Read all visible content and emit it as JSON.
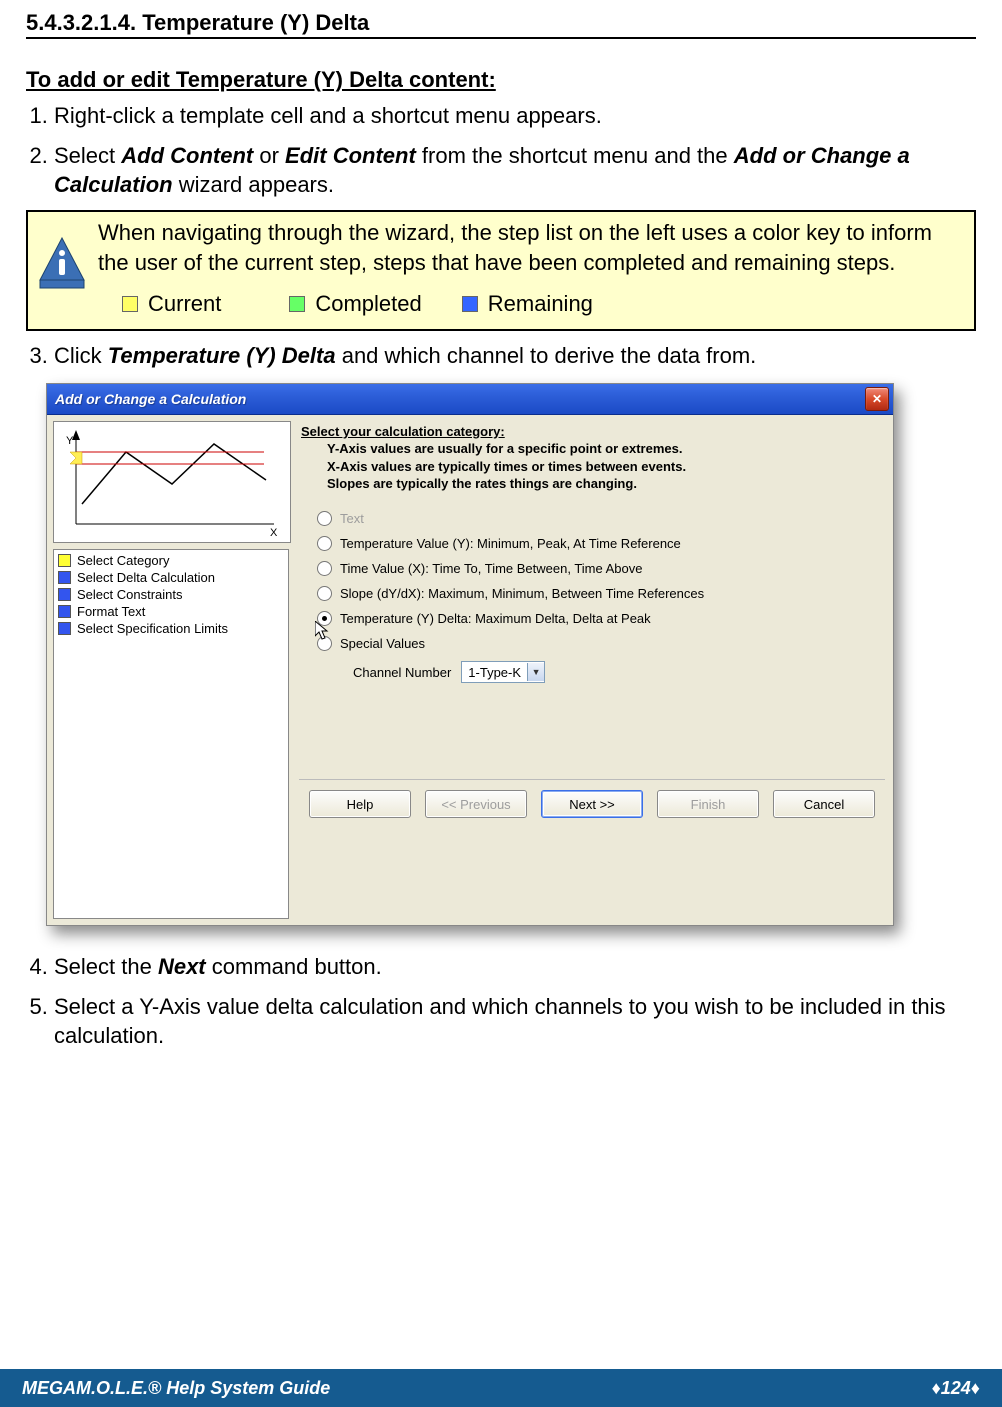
{
  "section": {
    "number": "5.4.3.2.1.4.",
    "title": "Temperature (Y) Delta"
  },
  "intro": {
    "heading": "To add or edit Temperature (Y) Delta content:"
  },
  "steps": {
    "s1": "Right-click a template cell and a shortcut menu appears.",
    "s2_a": "Select ",
    "s2_add": "Add Content",
    "s2_or": " or ",
    "s2_edit": "Edit Content",
    "s2_b": " from the shortcut menu and the ",
    "s2_wiz": "Add or Change a Calculation",
    "s2_c": " wizard appears.",
    "s3_a": "Click ",
    "s3_b": "Temperature (Y) Delta",
    "s3_c": " and which channel to derive the data from.",
    "s4_a": "Select the ",
    "s4_b": "Next",
    "s4_c": " command button.",
    "s5": "Select a Y-Axis value delta calculation and which channels to you wish to be included in this calculation."
  },
  "info": {
    "text": "When navigating through the wizard, the step list on the left uses a color key to inform the user of the current step, steps that have been completed and remaining steps.",
    "legend": {
      "current": "Current",
      "completed": "Completed",
      "remaining": "Remaining"
    }
  },
  "dialog": {
    "title": "Add or Change a Calculation",
    "steps": [
      {
        "color": "y",
        "label": "Select Category"
      },
      {
        "color": "b",
        "label": "Select Delta Calculation"
      },
      {
        "color": "b",
        "label": "Select Constraints"
      },
      {
        "color": "b",
        "label": "Format Text"
      },
      {
        "color": "b",
        "label": "Select Specification Limits"
      }
    ],
    "cat_heading": {
      "l1": "Select your calculation category:",
      "l2": "Y-Axis values are usually for a specific point or extremes.",
      "l3": "X-Axis values are typically times or times between events.",
      "l4": "Slopes are typically the rates things are changing."
    },
    "options": {
      "text": "Text",
      "tempval": "Temperature Value (Y):  Minimum, Peak, At Time Reference",
      "timeval": "Time Value (X):  Time To, Time Between, Time Above",
      "slope": "Slope (dY/dX):  Maximum, Minimum, Between Time References",
      "delta": "Temperature (Y) Delta:  Maximum Delta, Delta at Peak",
      "special": "Special  Values"
    },
    "channel": {
      "label": "Channel Number",
      "value": "1-Type-K"
    },
    "buttons": {
      "help": "Help",
      "prev": "<< Previous",
      "next": "Next >>",
      "finish": "Finish",
      "cancel": "Cancel"
    }
  },
  "footer": {
    "mega_bold": "MEGA",
    "rest": "M.O.L.E.® Help System Guide",
    "page": "♦124♦"
  }
}
